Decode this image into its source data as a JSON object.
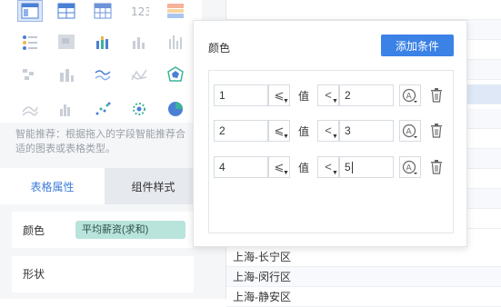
{
  "chart_hint": "智能推荐：根据拖入的字段智能推荐合适的图表或表格类型。",
  "chart_icons": [
    "table-icon",
    "crosstab-icon",
    "grouped-table-icon",
    "number-card-icon",
    "kpi-table-icon",
    "dot-matrix-icon",
    "heatmap-icon",
    "stacked-bar-icon",
    "bar-chart-icon",
    "column-chart-icon",
    "scatter-blocks-icon",
    "bar-chart-alt-icon",
    "line-chart-icon",
    "area-line-icon",
    "radar-icon",
    "area-chart-icon",
    "histogram-icon",
    "scatter-icon",
    "bubble-icon",
    "pie-chart-icon"
  ],
  "tabs": {
    "attr": "表格属性",
    "style": "组件样式"
  },
  "props": {
    "color_label": "颜色",
    "color_field": "平均薪资(求和)",
    "shape_label": "形状"
  },
  "table_rows": [
    "上海-长宁区",
    "上海-闵行区",
    "上海-静安区"
  ],
  "popup": {
    "title": "颜色",
    "add_button": "添加条件",
    "value_label": "值",
    "conditions": [
      {
        "left": "1",
        "left_op": "⩽",
        "right_op": "<",
        "right": "2"
      },
      {
        "left": "2",
        "left_op": "⩽",
        "right_op": "<",
        "right": "3"
      },
      {
        "left": "4",
        "left_op": "⩽",
        "right_op": "<",
        "right": "5"
      }
    ]
  },
  "colors": {
    "accent": "#3b82e6",
    "chip": "#b9e4dc",
    "highlight_row": "#dfe8f6"
  }
}
